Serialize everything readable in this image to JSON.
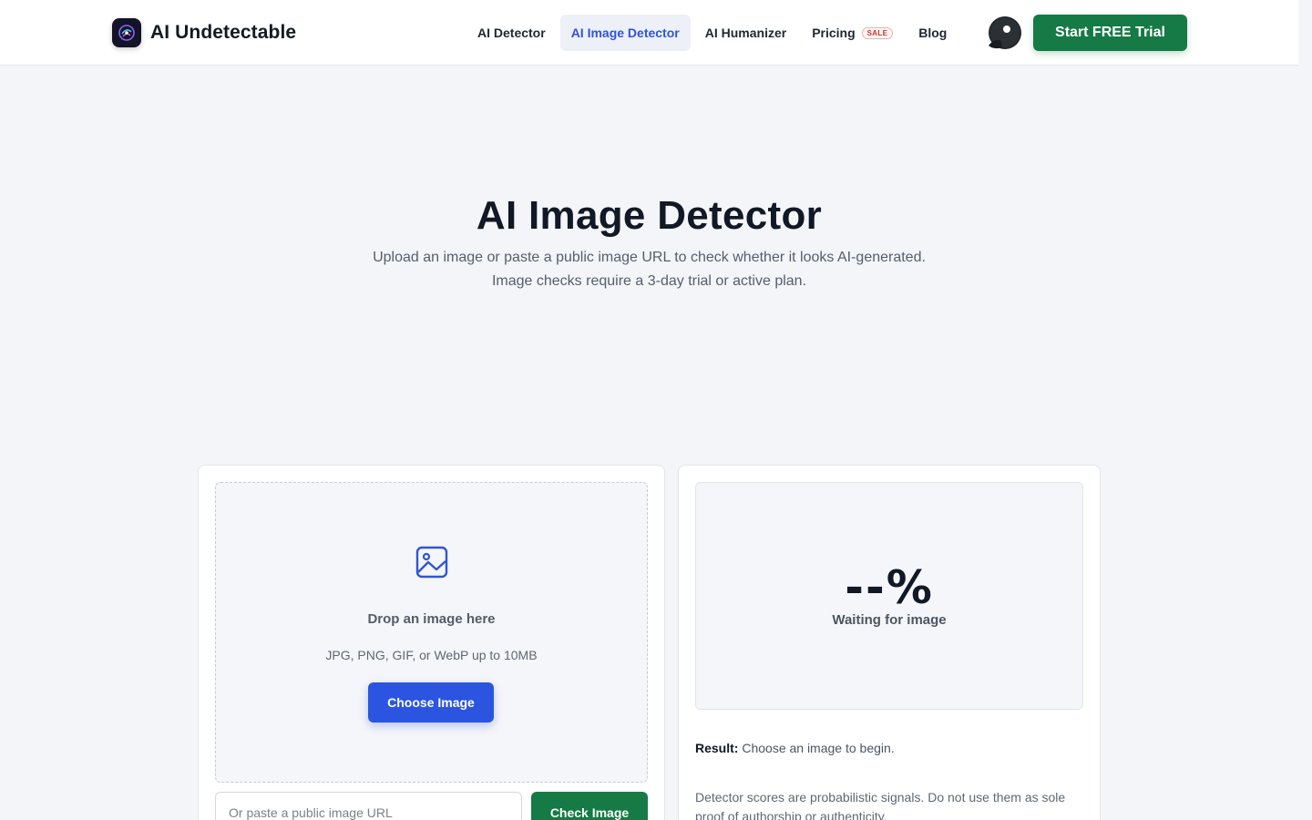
{
  "header": {
    "brand": "AI Undetectable",
    "nav": [
      {
        "label": "AI Detector",
        "active": false
      },
      {
        "label": "AI Image Detector",
        "active": true
      },
      {
        "label": "AI Humanizer",
        "active": false
      },
      {
        "label": "Pricing",
        "active": false,
        "badge": "SALE"
      },
      {
        "label": "Blog",
        "active": false
      }
    ],
    "cta_label": "Start FREE Trial",
    "icons": {
      "logo": "brain-logo-icon",
      "avatar": "user-avatar-icon"
    }
  },
  "hero": {
    "title": "AI Image Detector",
    "subtitle": "Upload an image or paste a public image URL to check whether it looks AI-generated. Image checks require a 3-day trial or active plan."
  },
  "upload": {
    "icon": "image-icon",
    "drop_title": "Drop an image here",
    "drop_hint": "JPG, PNG, GIF, or WebP up to 10MB",
    "choose_label": "Choose Image",
    "url_placeholder": "Or paste a public image URL",
    "check_label": "Check Image"
  },
  "result": {
    "score": "--%",
    "status": "Waiting for image",
    "label": "Result:",
    "text": "Choose an image to begin.",
    "disclaimer": "Detector scores are probabilistic signals. Do not use them as sole proof of authorship or authenticity."
  },
  "colors": {
    "primary_green": "#157a45",
    "primary_blue": "#2b55e0",
    "active_nav": "#2f55d4",
    "sale_red": "#c8322f",
    "page_bg": "#f4f5f9"
  }
}
